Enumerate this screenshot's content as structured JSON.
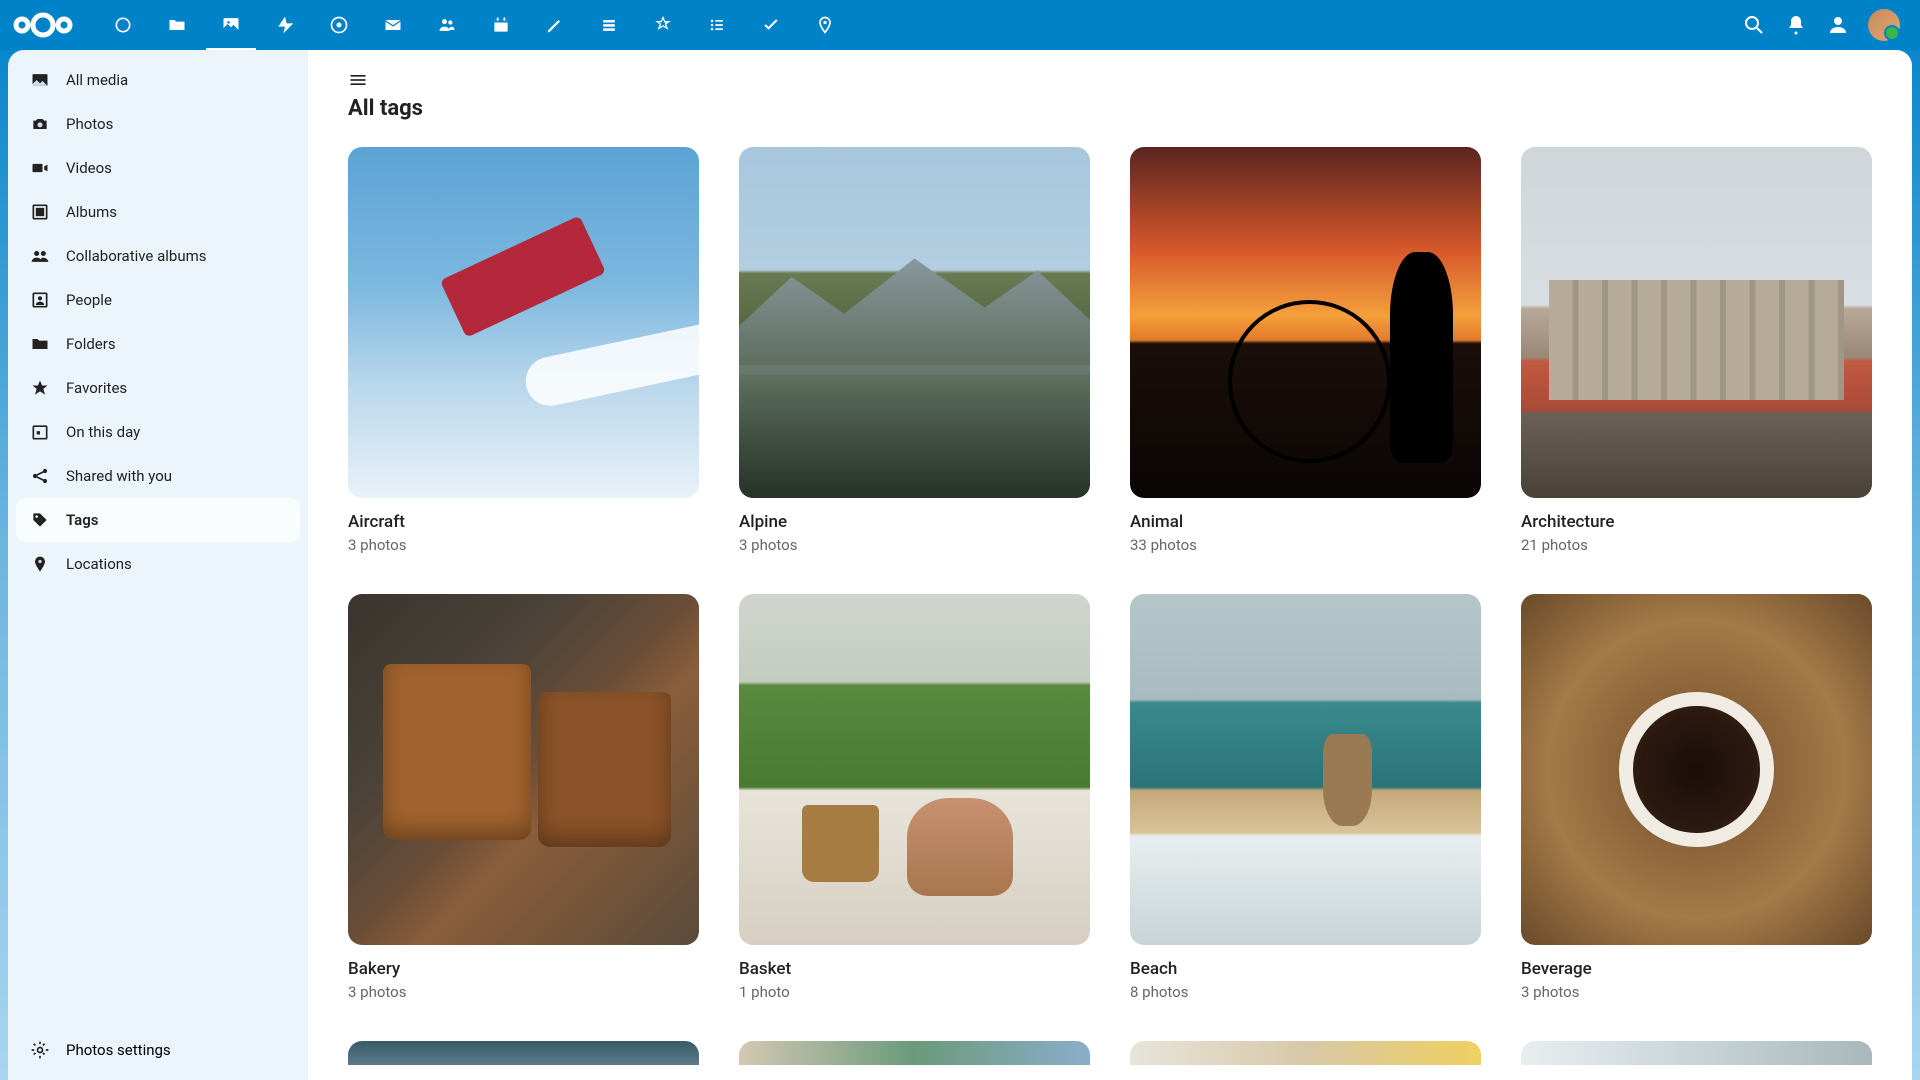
{
  "header": {
    "app_icons": [
      "dashboard",
      "files",
      "photos",
      "activity",
      "talk",
      "mail",
      "contacts",
      "calendar",
      "notes",
      "deck",
      "upgrade",
      "tasks-list",
      "tasks",
      "maps"
    ]
  },
  "sidebar": {
    "items": [
      {
        "label": "All media"
      },
      {
        "label": "Photos"
      },
      {
        "label": "Videos"
      },
      {
        "label": "Albums"
      },
      {
        "label": "Collaborative albums"
      },
      {
        "label": "People"
      },
      {
        "label": "Folders"
      },
      {
        "label": "Favorites"
      },
      {
        "label": "On this day"
      },
      {
        "label": "Shared with you"
      },
      {
        "label": "Tags"
      },
      {
        "label": "Locations"
      }
    ],
    "footer": "Photos settings"
  },
  "main": {
    "title": "All tags",
    "tags": [
      {
        "title": "Aircraft",
        "count": "3 photos"
      },
      {
        "title": "Alpine",
        "count": "3 photos"
      },
      {
        "title": "Animal",
        "count": "33 photos"
      },
      {
        "title": "Architecture",
        "count": "21 photos"
      },
      {
        "title": "Bakery",
        "count": "3 photos"
      },
      {
        "title": "Basket",
        "count": "1 photo"
      },
      {
        "title": "Beach",
        "count": "8 photos"
      },
      {
        "title": "Beverage",
        "count": "3 photos"
      }
    ]
  }
}
